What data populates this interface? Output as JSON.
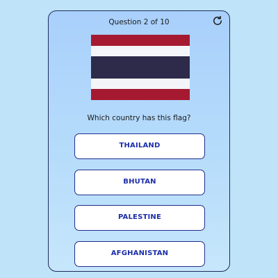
{
  "header": {
    "progress_text": "Question 2 of 10",
    "restart_icon": "restart-icon"
  },
  "flag": {
    "country_depicted": "Thailand",
    "stripe_colors": [
      "#a51931",
      "#f4f5f8",
      "#2d2a4a",
      "#f4f5f8",
      "#a51931"
    ]
  },
  "question": {
    "text": "Which country has this flag?"
  },
  "options": [
    {
      "label": "THAILAND"
    },
    {
      "label": "BHUTAN"
    },
    {
      "label": "PALESTINE"
    },
    {
      "label": "AFGHANISTAN"
    }
  ],
  "colors": {
    "background": "#bfe3f8",
    "card_border": "#1d2a5a",
    "option_text": "#1c2ea8",
    "option_border": "#1f2d8c"
  }
}
